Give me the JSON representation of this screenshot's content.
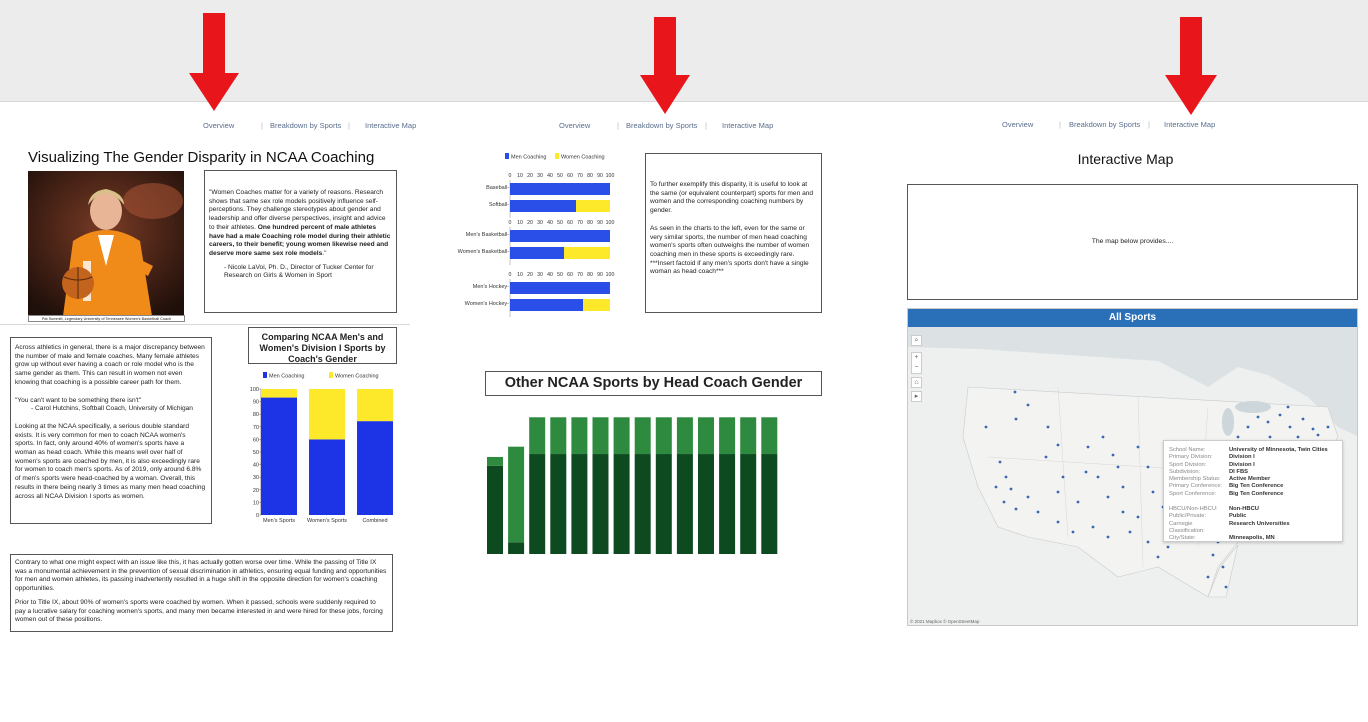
{
  "nav": {
    "overview": "Overview",
    "breakdown": "Breakdown by Sports",
    "map": "Interactive Map",
    "separator": "|"
  },
  "colors": {
    "arrow": "#e8161b",
    "men": "#1c33e6",
    "women": "#fde92a",
    "men_bar": "#2a4ee8",
    "other_men": "#0e4a1f",
    "other_women": "#2e8a3e",
    "map_header": "#2a70b8"
  },
  "panel1": {
    "title": "Visualizing The Gender Disparity in NCAA Coaching",
    "photo_caption": "Pat Summitt, Legendary University of Tennessee Women's Basketball Coach",
    "quote_plain": "\"Women Coaches matter for a variety of reasons. Research shows that same sex role models positively influence self-perceptions. They challenge stereotypes about gender and leadership and offer diverse perspectives, insight and advice to their athletes. ",
    "quote_bold": "One hundred percent of male athletes have had a male Coaching role model during their athletic careers, to their benefit; young women likewise need and deserve more same sex role models",
    "quote_end": ".\"",
    "quote_attribution": "- Nicole LaVoi, Ph. D., Director of Tucker Center for Research on Girls & Women in Sport",
    "intro_p1": "Across athletics in general, there is a major discrepancy between the number of male and female coaches. Many female athletes grow up without ever having a coach or role model who is the same gender as them. This can result in women not even knowing that coaching is a possible career path for them.",
    "intro_p2": "\"You can't want to be something there isn't\"",
    "intro_p2b": "- Carol Hutchins, Softball Coach, University of Michigan",
    "intro_p3": "Looking at the NCAA specifically, a serious double standard exists. It is very common for men to coach NCAA women's sports. In fact, only around 40% of women's sports have a woman as head coach. While this means well over half of women's sports are coached by men, it is also exceedingly rare for women to coach men's sports. As of 2019, only around 6.8% of men's sports were head-coached by a woman. Overall, this results in there being nearly 3 times as many men head coaching across all NCAA Division I sports as women.",
    "title9_p1": "Contrary to what one might expect with an issue like this, it has actually gotten worse over time. While the passing of Title IX was a monumental achievement in the prevention of sexual discrimination in athletics, ensuring equal funding and opportunities for men and women athletes, its passing inadvertently resulted in a huge shift in the opposite direction for women's coaching opportunities.",
    "title9_p2": "Prior to Title IX, about 90% of women's sports were coached by women. When it passed, schools were suddenly required to pay a lucrative salary for coaching women's sports, and many men became interested in and were hired for these jobs, forcing women out of these positions.",
    "chart_title": "Comparing NCAA Men's and Women's Division I Sports by Coach's Gender"
  },
  "panel2": {
    "explain_p1": "To further exemplify this disparity, it is useful to look at the same (or equivalent counterpart) sports for men and women and the corresponding coaching numbers by gender.",
    "explain_p2": "As seen in the charts to the left, even for the same or very similar sports, the number of men head coaching women's sports often outweighs the number of women coaching men in these sports is exceedingly rare.",
    "explain_p3": "***Insert factoid if any men's sports don't have a single woman as head coach***",
    "other_title": "Other NCAA Sports by Head Coach Gender"
  },
  "panel3": {
    "title": "Interactive Map",
    "intro": "The map below provides....",
    "map_title": "All Sports",
    "attribution": "© 2021 Mapbox  © OpenStreetMap",
    "tooltip": [
      {
        "k": "School Name:",
        "v": "University of Minnesota, Twin Cities"
      },
      {
        "k": "Primary Division:",
        "v": "Division I"
      },
      {
        "k": "Sport Division:",
        "v": "Division I"
      },
      {
        "k": "Subdivision:",
        "v": "DI FBS"
      },
      {
        "k": "Membership Status:",
        "v": "Active Member"
      },
      {
        "k": "Primary Conference:",
        "v": "Big Ten Conference"
      },
      {
        "k": "Sport Conference:",
        "v": "Big Ten Conference"
      },
      {
        "k": "",
        "v": ""
      },
      {
        "k": "HBCU/Non-HBCU:",
        "v": "Non-HBCU"
      },
      {
        "k": "Public/Private:",
        "v": "Public"
      },
      {
        "k": "Carnegie Classification:",
        "v": "Research Universities"
      },
      {
        "k": "City/State:",
        "v": "Minneapolis, MN"
      }
    ]
  },
  "chart_data": [
    {
      "type": "bar",
      "stacked": true,
      "legend": [
        "Men Coaching",
        "Women Coaching"
      ],
      "legend_position": "top",
      "categories": [
        "Men's Sports",
        "Women's Sports",
        "Combined"
      ],
      "series": [
        {
          "name": "Men Coaching",
          "values": [
            93.2,
            60,
            74.5
          ]
        },
        {
          "name": "Women Coaching",
          "values": [
            6.8,
            40,
            25.5
          ]
        }
      ],
      "ylim": [
        0,
        100
      ],
      "yticks": [
        "0",
        "10",
        "20",
        "30",
        "40",
        "50",
        "60",
        "70",
        "80",
        "90",
        "100"
      ],
      "grid": false
    },
    {
      "type": "bar",
      "orientation": "horizontal",
      "stacked": true,
      "legend": [
        "Men Coaching",
        "Women Coaching"
      ],
      "legend_position": "top",
      "xticks": [
        "0",
        "10",
        "20",
        "30",
        "40",
        "50",
        "60",
        "70",
        "80",
        "90",
        "100"
      ],
      "xlim": [
        0,
        100
      ],
      "groups": [
        {
          "categories": [
            "Baseball",
            "Softball"
          ],
          "men": [
            100,
            66
          ],
          "women": [
            0,
            34
          ]
        },
        {
          "categories": [
            "Men's Basketball",
            "Women's Basketball"
          ],
          "men": [
            100,
            54
          ],
          "women": [
            0,
            46
          ]
        },
        {
          "categories": [
            "Men's Hockey",
            "Women's Hockey"
          ],
          "men": [
            100,
            73
          ],
          "women": [
            0,
            27
          ]
        }
      ]
    },
    {
      "type": "bar",
      "stacked": true,
      "title": "Other NCAA Sports by Head Coach Gender",
      "bottom": [
        60,
        8,
        68,
        68,
        68,
        68,
        68,
        68,
        68,
        68,
        68,
        68,
        68,
        68
      ],
      "top": [
        6,
        65,
        25,
        25,
        25,
        25,
        25,
        25,
        25,
        25,
        25,
        25,
        25,
        25
      ],
      "ylim": [
        0,
        100
      ]
    }
  ]
}
